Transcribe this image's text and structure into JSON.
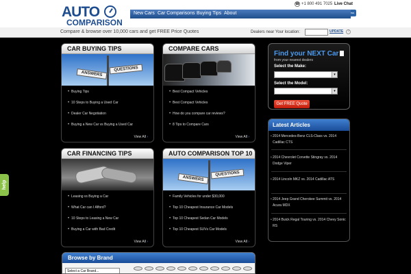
{
  "logo": {
    "word1": "AUTO",
    "word2": "COMPARISON"
  },
  "top": {
    "phone": "+1 800 491 7025",
    "chat": "Live Chat"
  },
  "social": [
    "f",
    "t",
    "g",
    "y",
    "rss"
  ],
  "nav": [
    "New Cars",
    "Car Comparisons",
    "Buying Tips",
    "About"
  ],
  "tagline": "Compare & browse over 10,000 cars and get FREE Price Quotes",
  "dealer": {
    "label": "Dealers near Your location:",
    "zip_value": "",
    "update": "UPDATE",
    "help": "?"
  },
  "tiles": [
    {
      "title": "CAR BUYING TIPS",
      "sign_a": "ANSWERS",
      "sign_b": "QUESTIONS",
      "links": [
        "Buying Tips",
        "10 Steps to Buying a Used Car",
        "Dealer Car Negotiation",
        "Buying a New Car vs Buying a Used Car"
      ],
      "view_all": "View All"
    },
    {
      "title": "COMPARE CARS",
      "links": [
        "Best Compact Vehicles",
        "Best Compact Vehicles",
        "How do you compare car reviews?",
        "8 Tips to Compare Cars"
      ],
      "view_all": "View All"
    },
    {
      "title": "CAR FINANCING TIPS",
      "links": [
        "Leasing vs Buying a Car",
        "What Car can I Afford?",
        "10 Steps to Leasing a New Car",
        "Buying a Car with Bad Credit"
      ],
      "view_all": "View All"
    },
    {
      "title": "AUTO COMPARISON TOP 10",
      "sign_a": "ANSWERS",
      "sign_b": "QUESTIONS",
      "links": [
        "Family Vehicles for under $30,000",
        "Top 10 Cheapest Insurance Car Models",
        "Top 10 Cheapest Sedan Car Models",
        "Top 10 Cheapest SUVs Car Models"
      ],
      "view_all": "View All"
    }
  ],
  "promo": {
    "title": "Find your NEXT Car",
    "subtitle": "from your nearest dealers",
    "make_label": "Select the Make:",
    "model_label": "Select the Model:",
    "button": "Get FREE Quote"
  },
  "articles": {
    "title": "Latest Articles",
    "items": [
      "2014 Mercedes-Benz CLS-Class vs. 2014 Cadillac CTS",
      "2014 Chevrolet Corvette Stingray vs. 2014 Dodge Viper",
      "2014 Lincoln MKZ vs. 2014 Cadillac ATS",
      "2014 Jeep Grand Cherokee Summit vs. 2014 Acura MDX",
      "2014 Buick Regal Touring vs. 2014 Chevy Sonic RS"
    ]
  },
  "brand": {
    "title": "Browse by Brand",
    "select_placeholder": "Select a Car Brand..."
  },
  "help_tab": "help",
  "colors": {
    "accent_blue": "#1d4c8f",
    "quote_red": "#d8281a",
    "help_green": "#8bc34a"
  }
}
